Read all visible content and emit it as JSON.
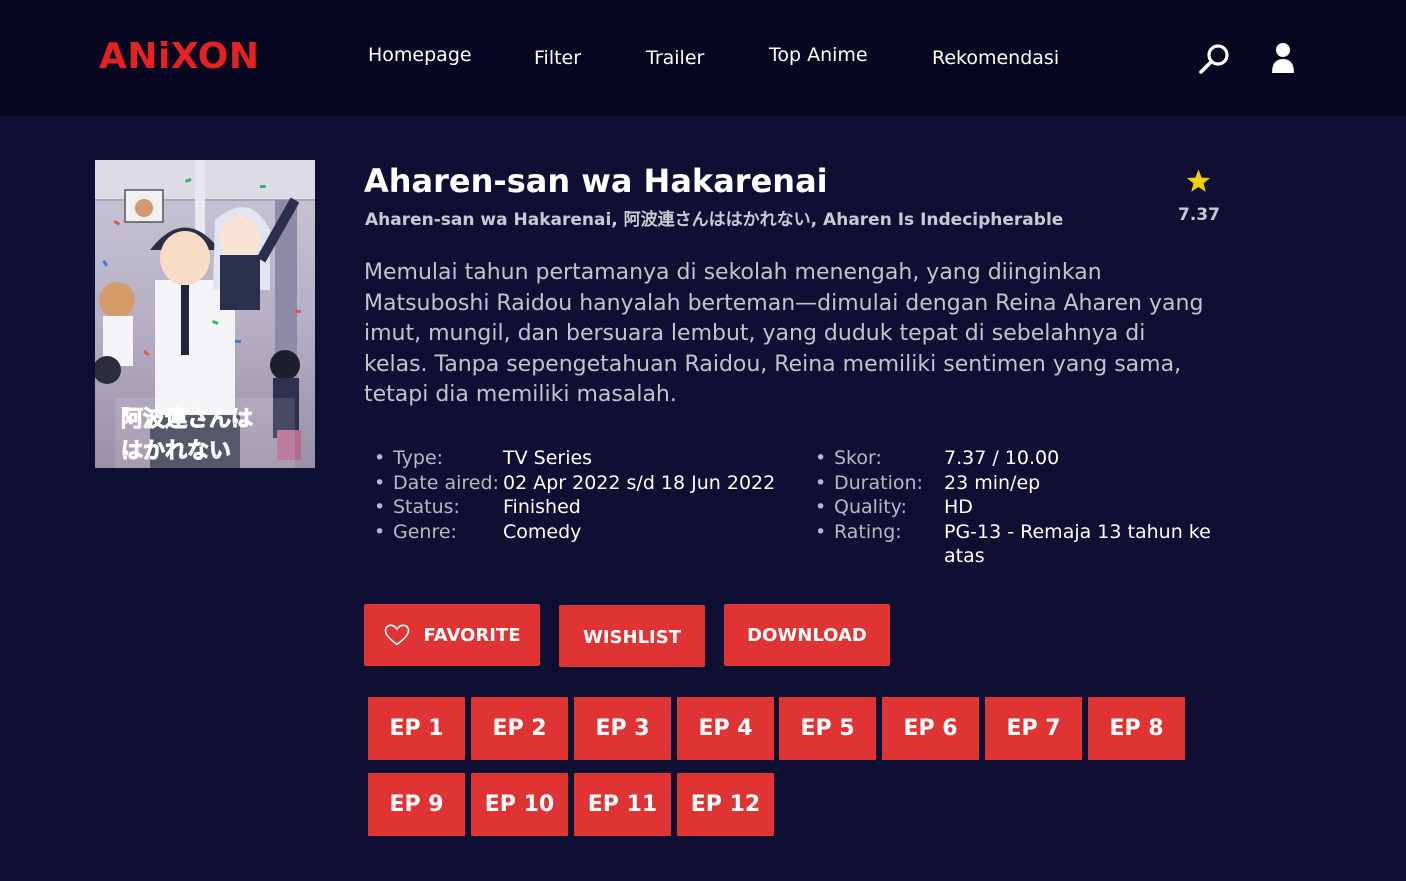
{
  "brand": {
    "name": "ANiXON",
    "color": "#e52222"
  },
  "nav": {
    "items": [
      {
        "label": "Homepage"
      },
      {
        "label": "Filter"
      },
      {
        "label": "Trailer"
      },
      {
        "label": "Top Anime"
      },
      {
        "label": "Rekomendasi"
      }
    ],
    "search_icon": "search-icon",
    "user_icon": "user-icon"
  },
  "anime": {
    "title": "Aharen-san wa Hakarenai",
    "alt_titles": "Aharen-san wa Hakarenai, 阿波連さんははかれない, Aharen Is Indecipherable",
    "score": "7.37",
    "synopsis": "Memulai tahun pertamanya di sekolah menengah, yang diinginkan Matsuboshi Raidou hanyalah berteman—dimulai dengan Reina Aharen yang imut, mungil, dan bersuara lembut, yang duduk tepat di sebelahnya di kelas. Tanpa sepengetahuan Raidou, Reina memiliki sentimen yang sama, tetapi dia memiliki masalah.",
    "poster_text": "阿波連さんは はかれない",
    "info_left": [
      {
        "label": "Type:",
        "value": "TV Series"
      },
      {
        "label": "Date aired:",
        "value": "02 Apr 2022 s/d 18 Jun 2022"
      },
      {
        "label": "Status:",
        "value": "Finished"
      },
      {
        "label": "Genre:",
        "value": "Comedy"
      }
    ],
    "info_right": [
      {
        "label": "Skor:",
        "value": "7.37 / 10.00"
      },
      {
        "label": "Duration:",
        "value": "23 min/ep"
      },
      {
        "label": "Quality:",
        "value": "HD"
      },
      {
        "label": "Rating:",
        "value": "PG-13 - Remaja 13 tahun ke atas"
      }
    ]
  },
  "actions": {
    "favorite": "FAVORITE",
    "wishlist": "WISHLIST",
    "download": "DOWNLOAD"
  },
  "episodes": [
    "EP 1",
    "EP 2",
    "EP 3",
    "EP 4",
    "EP 5",
    "EP 6",
    "EP 7",
    "EP 8",
    "EP 9",
    "EP 10",
    "EP 11",
    "EP 12"
  ],
  "colors": {
    "background": "#0e0f33",
    "header": "#070722",
    "accent": "#e03434",
    "star": "#f5d000"
  }
}
